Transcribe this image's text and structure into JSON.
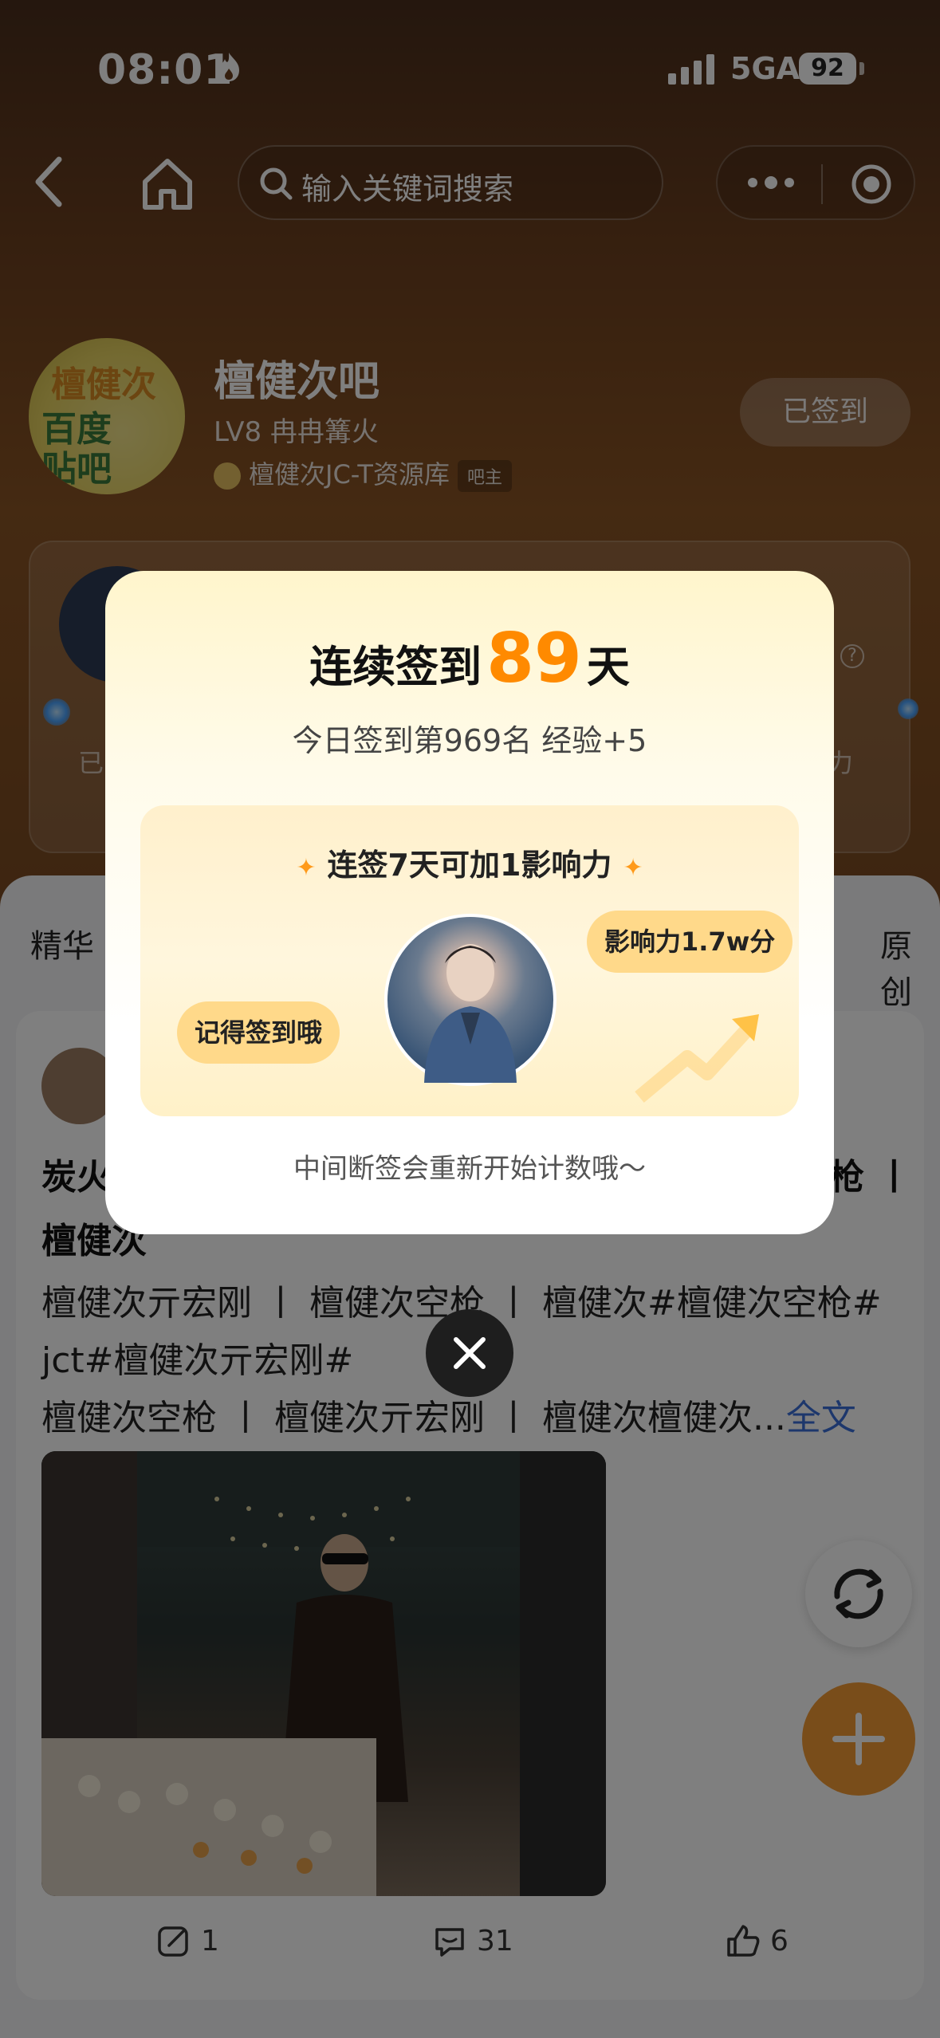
{
  "status_bar": {
    "time": "08:01",
    "network": "5GA",
    "battery": "92"
  },
  "nav": {
    "search_placeholder": "输入关键词搜索"
  },
  "forum": {
    "name": "檀健次吧",
    "level": "LV8 冉冉篝火",
    "owner": "檀健次JC-T资源库",
    "owner_badge": "吧主",
    "signed_label": "已签到",
    "avatar_text_1": "檀健次",
    "avatar_text_2": "百度",
    "avatar_text_3": "贴吧"
  },
  "info_card": {
    "left_label": "已",
    "right_label": "力"
  },
  "tabs": {
    "left": "精华",
    "right": "原创"
  },
  "post": {
    "title_start": "炭火",
    "title_end": "枪 丨",
    "title_line2": "檀健次",
    "line1": "檀健次亓宏刚 丨 檀健次空枪 丨 檀健次#檀健次空枪#",
    "line2": "jct#檀健次亓宏刚#",
    "line3": "檀健次空枪 丨 檀健次亓宏刚 丨 檀健次檀健次",
    "line3_ellipsis": "...",
    "more": "全文",
    "edit_count": "1",
    "comment_count": "31",
    "like_count": "6"
  },
  "modal": {
    "title_prefix": "连续签到",
    "days": "89",
    "title_suffix": "天",
    "subtitle": "今日签到第969名 经验+5",
    "panel_title": "连签7天可加1影响力",
    "bubble_left": "记得签到哦",
    "bubble_right": "影响力1.7w分",
    "footer": "中间断签会重新开始计数哦～"
  },
  "colors": {
    "accent_orange": "#ff8a00",
    "fab_orange": "#f39a35",
    "link_blue": "#3a6fd8"
  }
}
